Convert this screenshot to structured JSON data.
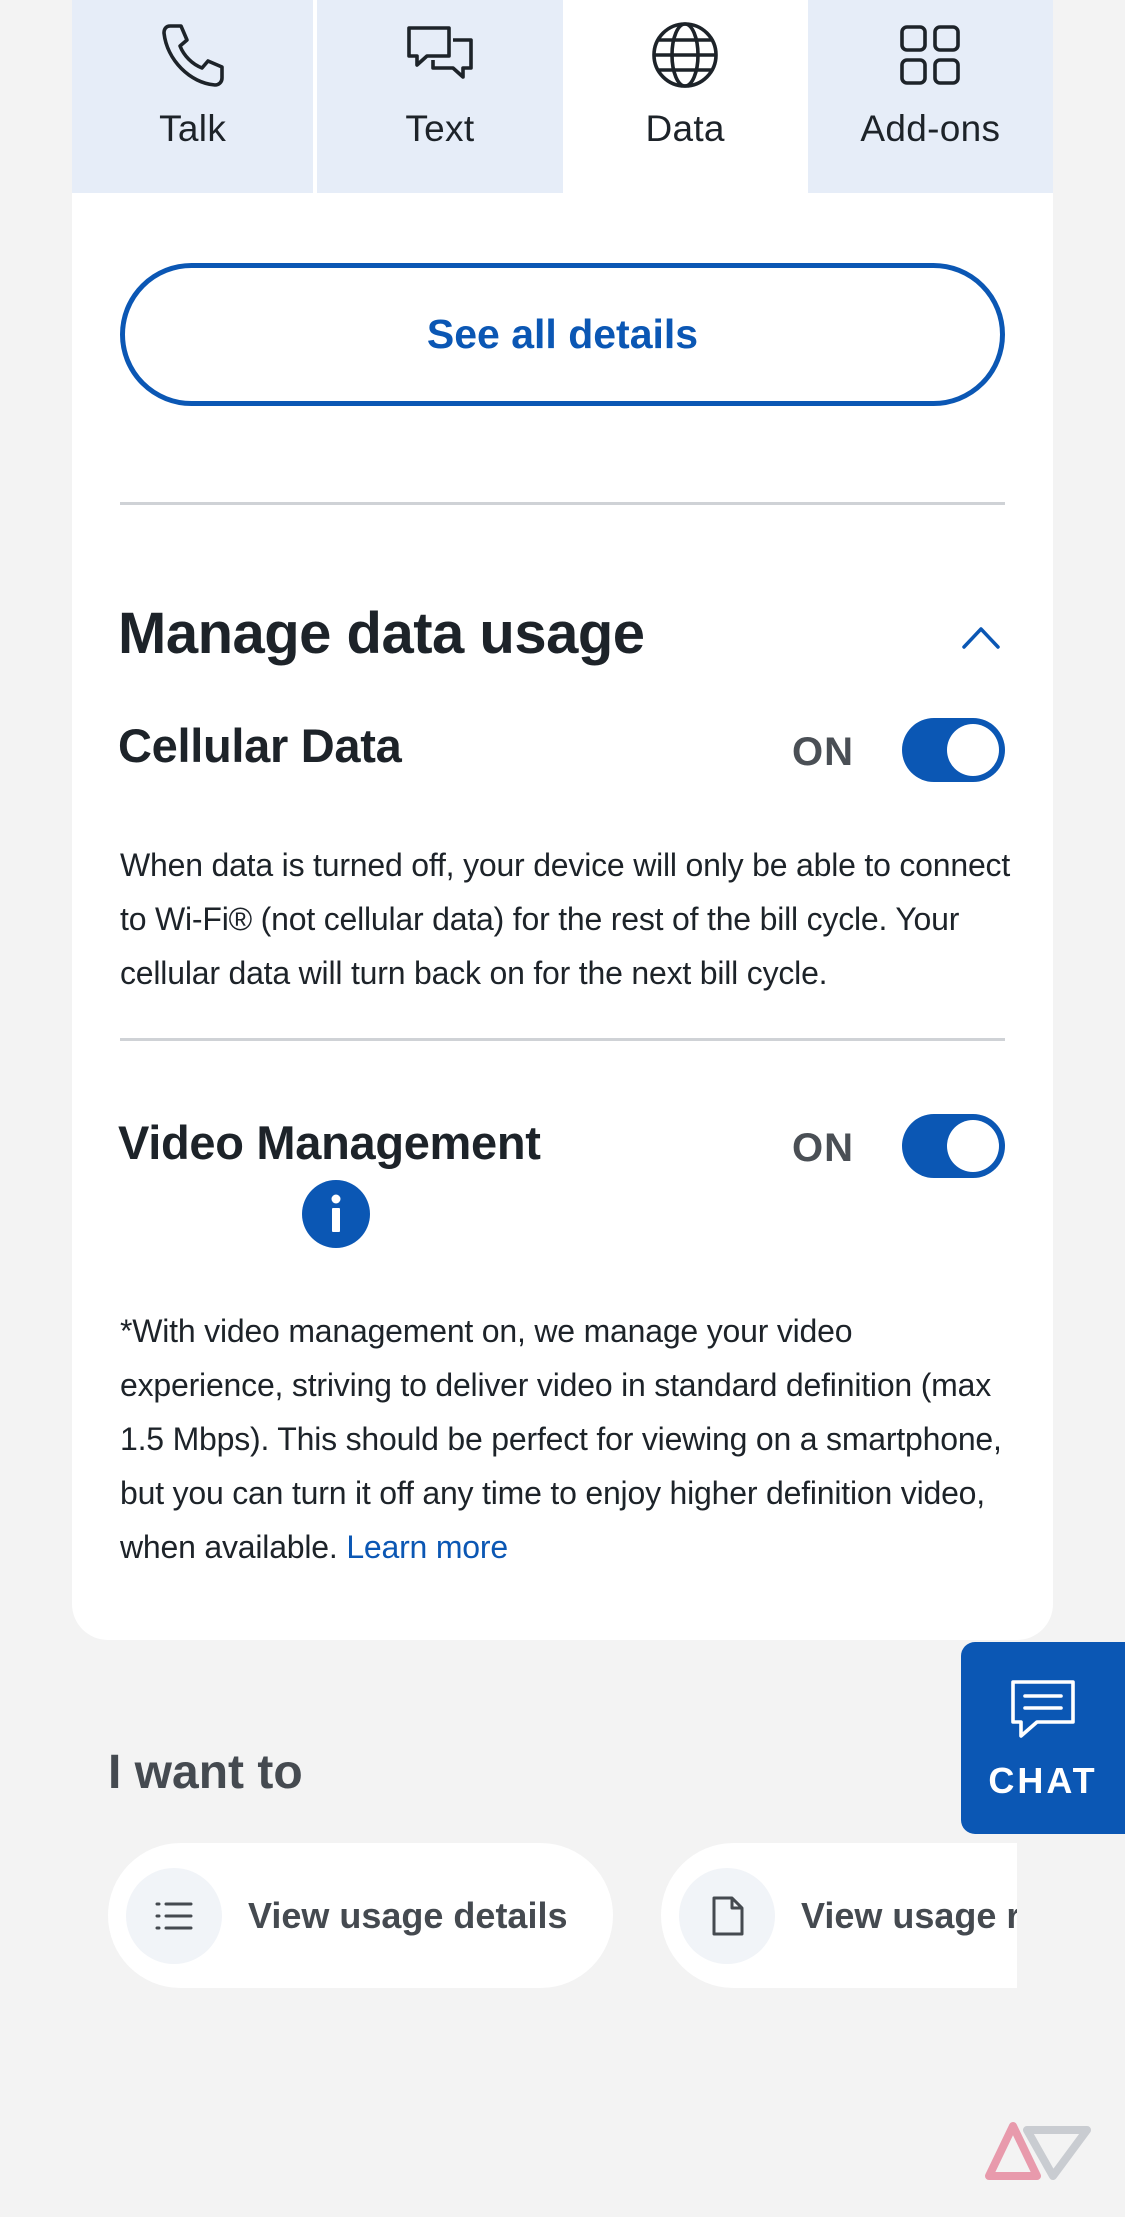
{
  "tabs": [
    {
      "label": "Talk",
      "icon": "phone-icon",
      "active": false
    },
    {
      "label": "Text",
      "icon": "chat-bubbles-icon",
      "active": false
    },
    {
      "label": "Data",
      "icon": "globe-icon",
      "active": true
    },
    {
      "label": "Add-ons",
      "icon": "grid-icon",
      "active": false
    }
  ],
  "see_all_label": "See all details",
  "manage": {
    "title": "Manage data usage",
    "cellular": {
      "title": "Cellular Data",
      "status": "ON",
      "description": "When data is turned off, your device will only be able to connect to Wi-Fi® (not cellular data) for the rest of the bill cycle. Your cellular data will turn back on for the next bill cycle."
    },
    "video": {
      "title": "Video Management",
      "status": "ON",
      "description": "*With video management on, we manage your video experience, striving to deliver video in standard definition (max 1.5 Mbps). This should be perfect for viewing on a smartphone, but you can turn it off any time to enjoy higher definition video, when available.",
      "link": "Learn more"
    }
  },
  "chat_label": "CHAT",
  "i_want_to": {
    "title": "I want to",
    "chips": [
      {
        "label": "View usage details",
        "icon": "list-icon"
      },
      {
        "label": "View usage r",
        "icon": "document-icon"
      }
    ]
  },
  "colors": {
    "accent": "#0b57b4",
    "tab_bg": "#e6edf8",
    "page_bg": "#f3f3f3"
  }
}
